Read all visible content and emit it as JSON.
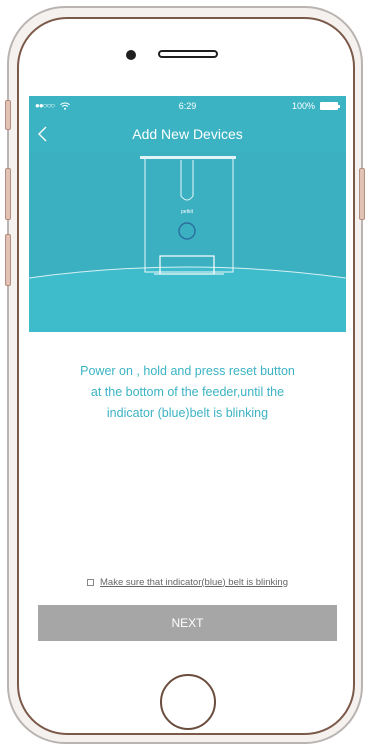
{
  "status_bar": {
    "signal": "●●○○○",
    "time": "6:29",
    "battery": "100%"
  },
  "nav": {
    "title": "Add New Devices",
    "back_icon": "chevron-left-icon"
  },
  "device": {
    "brand_label": "petkit"
  },
  "instruction": {
    "line1": "Power on , hold and press reset button",
    "line2": "at the bottom of the feeder,until the",
    "line3": "indicator (blue)belt is blinking"
  },
  "confirm": {
    "label": "Make sure that indicator(blue) belt is blinking",
    "checked": false
  },
  "next_button": {
    "label": "NEXT"
  },
  "colors": {
    "accent": "#3bb3c3",
    "button_disabled": "#a6a6a6"
  }
}
